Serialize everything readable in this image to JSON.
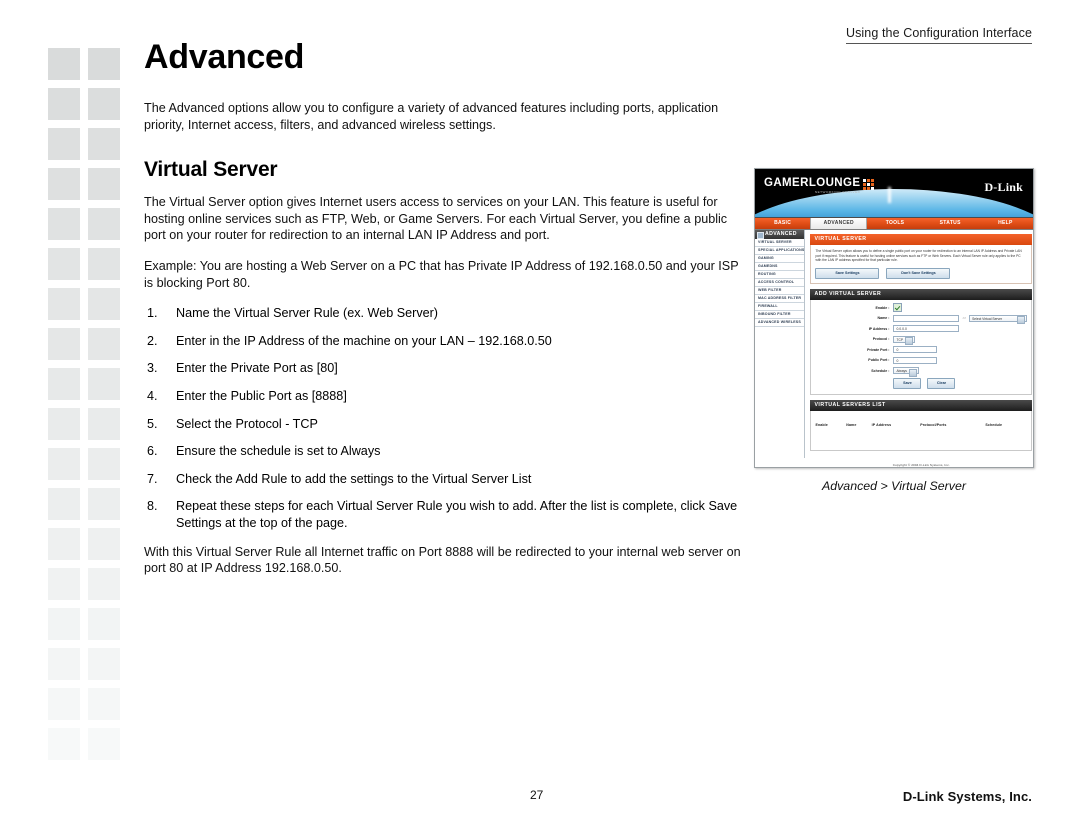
{
  "header": {
    "running_head": "Using the Configuration Interface"
  },
  "page": {
    "title": "Advanced",
    "section_title": "Virtual Server",
    "intro": "The Advanced options allow you to configure a variety of advanced features including ports, application priority, Internet access, filters, and advanced wireless settings.",
    "paragraph_1": "The Virtual Server option gives Internet users access to services on your LAN. This feature is useful for hosting online services such as FTP, Web, or Game Servers. For each Virtual Server, you define a public port on your router for redirection to an internal LAN IP Address and port.",
    "paragraph_2": "Example: You are hosting a Web Server on a PC that has Private IP Address of 192.168.0.50 and your ISP is blocking Port 80.",
    "steps": [
      {
        "num": "1.",
        "text": "Name the Virtual Server Rule (ex. Web Server)"
      },
      {
        "num": "2.",
        "text": "Enter in the IP Address of the machine on your LAN – 192.168.0.50"
      },
      {
        "num": "3.",
        "text": "Enter the Private Port as [80]"
      },
      {
        "num": "4.",
        "text": "Enter the Public Port as [8888]"
      },
      {
        "num": "5.",
        "text": "Select the Protocol - TCP"
      },
      {
        "num": "6.",
        "text": "Ensure the schedule is set to Always"
      },
      {
        "num": "7.",
        "text": "Check the Add Rule to add the settings to the Virtual Server List"
      },
      {
        "num": "8.",
        "text": "Repeat these steps for each Virtual Server Rule you wish to add. After the list is complete, click Save Settings at the top of the page."
      }
    ],
    "closing": "With this Virtual Server Rule all Internet traffic on Port 8888 will be redirected to your internal web server on port 80 at IP Address 192.168.0.50."
  },
  "figure": {
    "caption": "Advanced > Virtual Server",
    "router": {
      "brand_primary": "GAMER",
      "brand_secondary": "LOUNGE",
      "brand_tagline": "NETWORKING EVOLVED",
      "vendor": "D-Link",
      "nav_tabs": [
        {
          "label": "BASIC",
          "active": false
        },
        {
          "label": "ADVANCED",
          "active": true
        },
        {
          "label": "TOOLS",
          "active": false
        },
        {
          "label": "STATUS",
          "active": false
        },
        {
          "label": "HELP",
          "active": false
        }
      ],
      "sidebar_title": "ADVANCED",
      "sidebar_items": [
        "VIRTUAL SERVER",
        "SPECIAL APPLICATIONS",
        "GAMING",
        "GAMEDNS",
        "ROUTING",
        "ACCESS CONTROL",
        "WEB FILTER",
        "MAC ADDRESS FILTER",
        "FIREWALL",
        "INBOUND FILTER",
        "ADVANCED WIRELESS"
      ],
      "panel_virtual_server": {
        "title": "VIRTUAL SERVER",
        "description": "The Virtual Server option allows you to define a single public port on your router for redirection to an internal LAN IP Address and Private LAN port if required. This feature is useful for hosting online services such as FTP or Web Servers. Each Virtual Server rule only applies to the PC with the LAN IP address specified for that particular rule.",
        "save_label": "Save Settings",
        "dont_save_label": "Don't Save Settings"
      },
      "panel_add_virtual_server": {
        "title": "ADD VIRTUAL SERVER",
        "fields": {
          "enable_label": "Enable :",
          "name_label": "Name :",
          "name_value": "",
          "name_or": "<< ",
          "name_select": "Select Virtual Server",
          "ip_label": "IP Address :",
          "ip_value": "0.0.0.0",
          "protocol_label": "Protocol :",
          "protocol_value": "TCP",
          "private_port_label": "Private Port :",
          "private_port_value": "0",
          "public_port_label": "Public Port :",
          "public_port_value": "0",
          "schedule_label": "Schedule :",
          "schedule_value": "Always"
        },
        "save_label": "Save",
        "clear_label": "Clear"
      },
      "panel_list": {
        "title": "VIRTUAL SERVERS LIST",
        "columns": [
          "Enable",
          "Name",
          "IP Address",
          "Protocol/Ports",
          "Schedule"
        ],
        "rows": []
      },
      "copyright": "Copyright © 2004 D-Link Systems, Inc."
    }
  },
  "footer": {
    "page_number": "27",
    "brand": "D-Link Systems, Inc."
  }
}
